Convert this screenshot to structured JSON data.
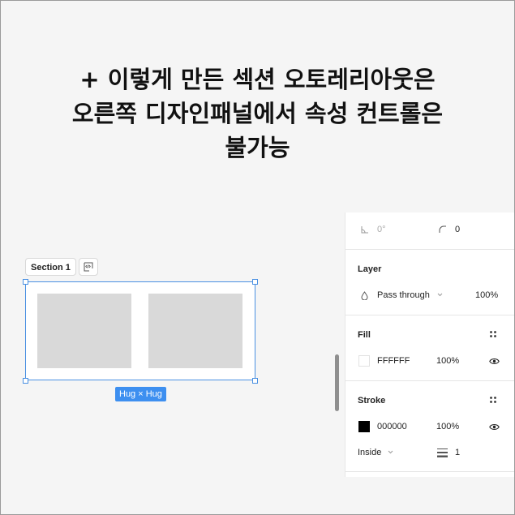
{
  "headline": {
    "line1": "+ 이렇게 만든 섹션 오토레리아웃은",
    "line2": "오른쪽 디자인패널에서 속성 컨트롤은",
    "line3": "불가능"
  },
  "canvas": {
    "section_label": "Section 1",
    "hug_badge": "Hug × Hug"
  },
  "panel": {
    "rotation_value": "0°",
    "radius_value": "0",
    "layer": {
      "title": "Layer",
      "blend_mode": "Pass through",
      "opacity": "100%"
    },
    "fill": {
      "title": "Fill",
      "hex": "FFFFFF",
      "opacity": "100%",
      "color": "#FFFFFF"
    },
    "stroke": {
      "title": "Stroke",
      "hex": "000000",
      "opacity": "100%",
      "color": "#000000",
      "position": "Inside",
      "weight": "1"
    }
  },
  "colors": {
    "selection": "#4a90e2",
    "badge": "#3d8ff0"
  }
}
